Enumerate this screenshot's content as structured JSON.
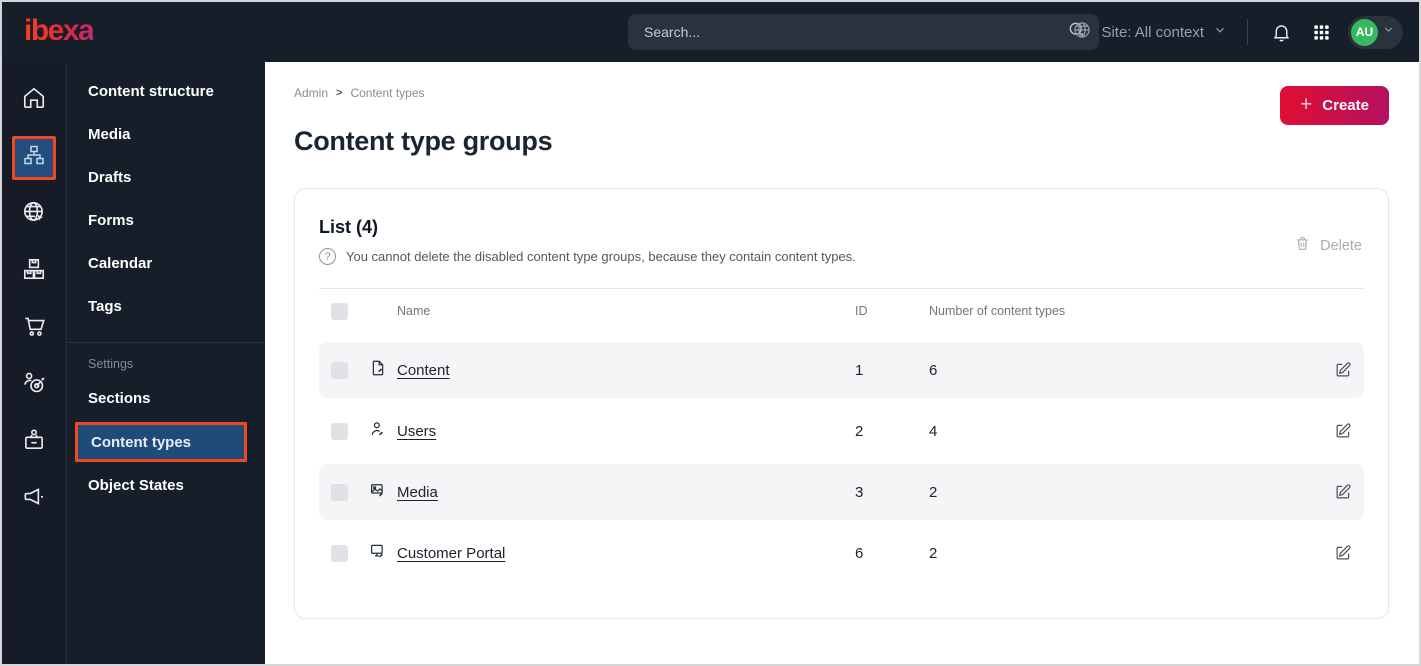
{
  "topbar": {
    "logo": "ibexa",
    "search": {
      "placeholder": "Search..."
    },
    "site_context": {
      "label": "Site: All context"
    },
    "avatar": {
      "initials": "AU"
    }
  },
  "icon_rail": {
    "items": [
      {
        "icon": "home-icon",
        "active": false
      },
      {
        "icon": "sitemap-icon",
        "active": true
      },
      {
        "icon": "globe-pointer-icon",
        "active": false
      },
      {
        "icon": "boxes-icon",
        "active": false
      },
      {
        "icon": "cart-icon",
        "active": false
      },
      {
        "icon": "person-target-icon",
        "active": false
      },
      {
        "icon": "id-badge-icon",
        "active": false
      },
      {
        "icon": "megaphone-icon",
        "active": false
      }
    ]
  },
  "sidebar": {
    "items": [
      "Content structure",
      "Media",
      "Drafts",
      "Forms",
      "Calendar",
      "Tags"
    ],
    "settings_header": "Settings",
    "settings_items": [
      {
        "label": "Sections",
        "active": false
      },
      {
        "label": "Content types",
        "active": true
      },
      {
        "label": "Object States",
        "active": false
      }
    ]
  },
  "main": {
    "breadcrumb": {
      "0": "Admin",
      "separator": ">",
      "1": "Content types"
    },
    "create": {
      "plus": "+",
      "label": "Create"
    },
    "title": "Content type groups",
    "list": {
      "title": "List (4)",
      "note_icon": "?",
      "note": "You cannot delete the disabled content type groups, because they contain content types.",
      "delete_label": "Delete",
      "columns": {
        "name": "Name",
        "id": "ID",
        "count": "Number of content types"
      },
      "rows": [
        {
          "icon": "file-icon",
          "name": "Content",
          "id": "1",
          "count": "6"
        },
        {
          "icon": "user-icon",
          "name": "Users",
          "id": "2",
          "count": "4"
        },
        {
          "icon": "image-icon",
          "name": "Media",
          "id": "3",
          "count": "2"
        },
        {
          "icon": "monitor-icon",
          "name": "Customer Portal",
          "id": "6",
          "count": "2"
        }
      ]
    }
  },
  "colors": {
    "topbar_bg": "#161e29",
    "accent_orange": "#f0481f",
    "highlight_blue": "#1f4b7b",
    "create_gradient_start": "#e00f34",
    "create_gradient_end": "#b41060",
    "avatar_green": "#35b860",
    "row_shade": "#f5f5f7",
    "link_dark": "#1a232e"
  }
}
